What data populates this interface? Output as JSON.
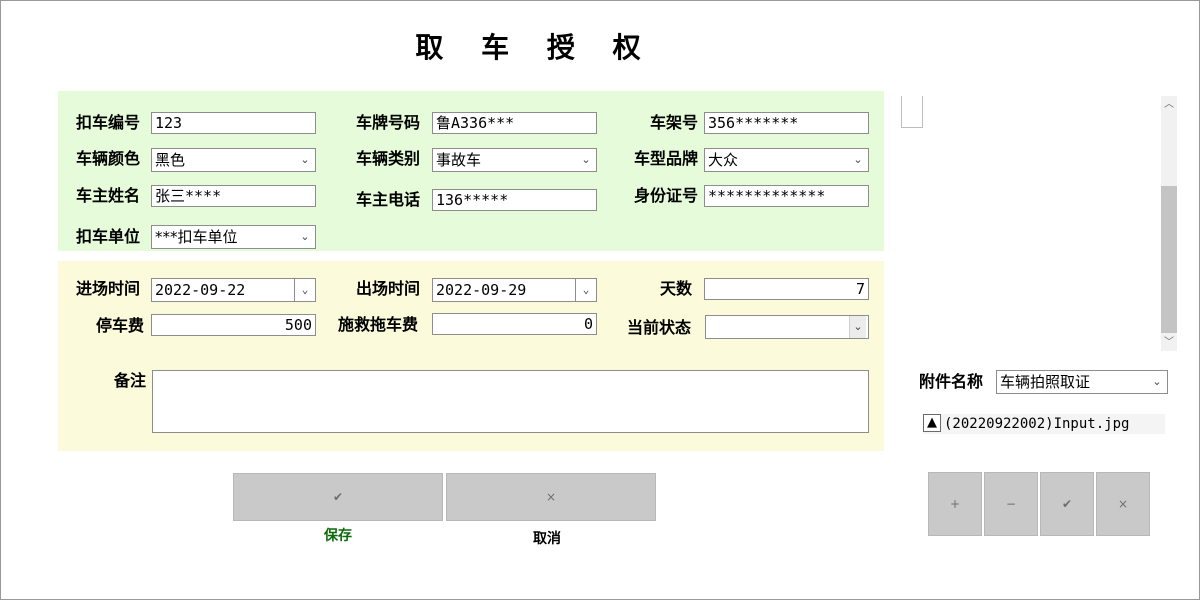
{
  "title": "取 车 授 权",
  "vehicle": {
    "impound_no_label": "扣车编号",
    "impound_no": "123",
    "plate_label": "车牌号码",
    "plate": "鲁A336***",
    "frame_label": "车架号",
    "frame": "356*******",
    "color_label": "车辆颜色",
    "color": "黑色",
    "type_label": "车辆类别",
    "type": "事故车",
    "brand_label": "车型品牌",
    "brand": "大众",
    "owner_label": "车主姓名",
    "owner": "张三****",
    "phone_label": "车主电话",
    "phone": "136*****",
    "id_label": "身份证号",
    "id_no": "*************",
    "unit_label": "扣车单位",
    "unit": "***扣车单位"
  },
  "parking": {
    "in_time_label": "进场时间",
    "in_time": "2022-09-22",
    "out_time_label": "出场时间",
    "out_time": "2022-09-29",
    "days_label": "天数",
    "days": "7",
    "fee_label": "停车费",
    "fee": "500",
    "tow_label": "施救拖车费",
    "tow": "0",
    "status_label": "当前状态",
    "status": "",
    "remark_label": "备注",
    "remark": ""
  },
  "actions": {
    "save_icon": "✔",
    "save_label": "保存",
    "cancel_icon": "×",
    "cancel_label": "取消"
  },
  "attachment": {
    "name_label": "附件名称",
    "name_value": "车辆拍照取证",
    "file_icon": "▲",
    "file_name": "(20220922002)Input.jpg",
    "buttons": [
      "+",
      "−",
      "✔",
      "×"
    ]
  },
  "colors": {
    "panel_green": "#e6fbd9",
    "panel_yellow": "#fbfbdc",
    "save_text": "#0a6a0a",
    "button_gray": "#c9c9c9"
  }
}
